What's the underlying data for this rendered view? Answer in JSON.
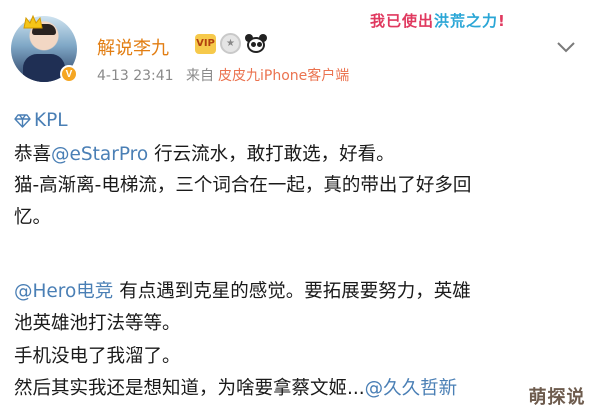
{
  "post": {
    "author_name": "解说李九",
    "timestamp": "4-13 23:41",
    "source_prefix": "来自",
    "source_client": "皮皮九iPhone客户端",
    "banner_text_a": "我已使出",
    "banner_text_b": "洪荒之力",
    "banner_text_c": "!",
    "vip_badge": "VIP",
    "v_badge": "V"
  },
  "content": {
    "topic": "KPL",
    "line1_prefix": "恭喜",
    "line1_mention": "@eStarPro",
    "line1_rest": " 行云流水，敢打敢选，好看。",
    "line2": "猫-高渐离-电梯流，三个词合在一起，真的带出了好多回",
    "line3": "忆。",
    "line4_mention": "@Hero电竞",
    "line4_rest": " 有点遇到克星的感觉。要拓展要努力，英雄",
    "line5": "池英雄池打法等等。",
    "line6": "手机没电了我溜了。",
    "line7_prefix": "然后其实我还是想知道，为啥要拿蔡文姬...",
    "line7_mention": "@久久哲新"
  },
  "watermark": "萌探说",
  "colors": {
    "name": "#e27e13",
    "link": "#4a7fb5",
    "meta": "#8a8a8a",
    "source": "#eb7350"
  },
  "icons": [
    "crown-icon",
    "verified-badge-icon",
    "vip-badge-icon",
    "medal-badge-icon",
    "panda-badge-icon",
    "chevron-down-icon",
    "diamond-topic-icon"
  ]
}
